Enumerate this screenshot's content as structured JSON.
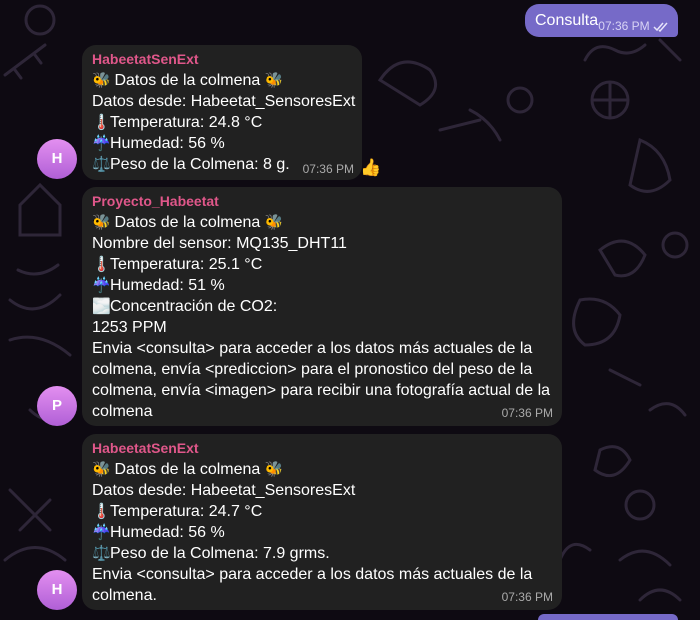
{
  "outgoing": {
    "text": "Consulta",
    "time": "07:36 PM",
    "status_icon": "double-check-icon"
  },
  "messages": [
    {
      "sender": "HabeetatSenExt",
      "avatar": "H",
      "time": "07:36 PM",
      "reaction": "👍",
      "lines": [
        {
          "icon": "🐝",
          "text": "Datos de la colmena",
          "icon_after": "🐝"
        },
        {
          "text": "Datos desde: Habeetat_SensoresExt"
        },
        {
          "icon": "🌡️",
          "text": "Temperatura: 24.8 °C"
        },
        {
          "icon": "☔",
          "text": "Humedad: 56 %"
        },
        {
          "icon": "⚖️",
          "text": "Peso de la Colmena: 8 g."
        }
      ]
    },
    {
      "sender": "Proyecto_Habeetat",
      "avatar": "P",
      "time": "07:36 PM",
      "lines": [
        {
          "icon": "🐝",
          "text": "Datos de la colmena",
          "icon_after": "🐝"
        },
        {
          "text": "Nombre del sensor: MQ135_DHT11"
        },
        {
          "icon": "🌡️",
          "text": "Temperatura: 25.1 °C"
        },
        {
          "icon": "☔",
          "text": "Humedad: 51 %"
        },
        {
          "icon": "🌫️",
          "text": "Concentración de CO2:"
        },
        {
          "text": "1253 PPM"
        }
      ],
      "paragraph": "Envia <consulta> para acceder a los datos más actuales de la colmena, envía <prediccion> para el pronostico del peso de la colmena, envía <imagen> para recibir una fotografía actual de la colmena"
    },
    {
      "sender": "HabeetatSenExt",
      "avatar": "H",
      "time": "07:36 PM",
      "lines": [
        {
          "icon": "🐝",
          "text": "Datos de la colmena",
          "icon_after": "🐝"
        },
        {
          "text": "Datos desde: Habeetat_SensoresExt"
        },
        {
          "icon": "🌡️",
          "text": "Temperatura: 24.7 °C"
        },
        {
          "icon": "☔",
          "text": "Humedad: 56 %"
        },
        {
          "icon": "⚖️",
          "text": "Peso de la Colmena: 7.9 grms."
        }
      ],
      "paragraph": "Envia <consulta> para acceder a los datos más actuales de la colmena."
    }
  ],
  "colors": {
    "incoming_bubble": "#212121",
    "outgoing_bubble": "#766ac8",
    "sender_name": "#e0578a",
    "background": "#0e0a12"
  }
}
